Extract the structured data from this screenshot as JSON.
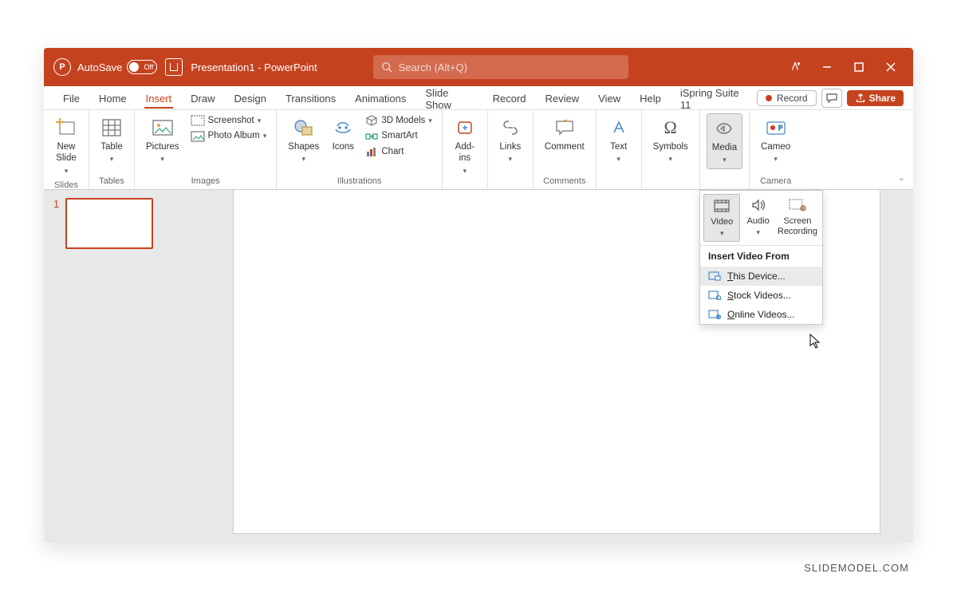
{
  "titlebar": {
    "autosave_label": "AutoSave",
    "toggle_state": "Off",
    "doc_title": "Presentation1  -  PowerPoint",
    "search_placeholder": "Search (Alt+Q)"
  },
  "tabs": {
    "items": [
      "File",
      "Home",
      "Insert",
      "Draw",
      "Design",
      "Transitions",
      "Animations",
      "Slide Show",
      "Record",
      "Review",
      "View",
      "Help",
      "iSpring Suite 11"
    ],
    "active_index": 2,
    "record_btn": "Record",
    "share_btn": "Share"
  },
  "ribbon": {
    "slides": {
      "group": "Slides",
      "new_slide": "New\nSlide"
    },
    "tables": {
      "group": "Tables",
      "table": "Table"
    },
    "images": {
      "group": "Images",
      "pictures": "Pictures",
      "screenshot": "Screenshot",
      "photo_album": "Photo Album"
    },
    "illustrations": {
      "group": "Illustrations",
      "shapes": "Shapes",
      "icons": "Icons",
      "models": "3D Models",
      "smartart": "SmartArt",
      "chart": "Chart"
    },
    "addins": {
      "label": "Add-\nins"
    },
    "links": {
      "label": "Links"
    },
    "comments": {
      "group": "Comments",
      "comment": "Comment"
    },
    "text": {
      "label": "Text"
    },
    "symbols": {
      "label": "Symbols"
    },
    "media": {
      "label": "Media"
    },
    "camera": {
      "group": "Camera",
      "cameo": "Cameo"
    }
  },
  "media_dropdown": {
    "video": "Video",
    "audio": "Audio",
    "screen_recording": "Screen\nRecording",
    "header": "Insert Video From",
    "this_device": "This Device...",
    "stock_videos": "Stock Videos...",
    "online_videos": "Online Videos..."
  },
  "thumbnail": {
    "number": "1"
  },
  "watermark": "SLIDEMODEL.COM"
}
